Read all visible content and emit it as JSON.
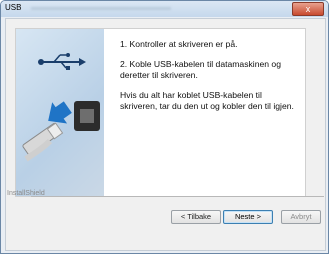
{
  "window": {
    "title": "USB",
    "close_label": "x"
  },
  "content": {
    "step1": "1. Kontroller at skriveren er på.",
    "step2": "2. Koble USB-kabelen til datamaskinen og deretter til skriveren.",
    "note": "Hvis du alt har koblet USB-kabelen til skriveren, tar du den ut og kobler den til igjen."
  },
  "footer": {
    "brand": "InstallShield"
  },
  "buttons": {
    "back": "< Tilbake",
    "next": "Neste >",
    "cancel": "Avbryt"
  },
  "icons": {
    "usb": "usb-icon",
    "arrow": "arrow-right-icon",
    "plug": "usb-plug-icon"
  },
  "colors": {
    "accent": "#1f74c6",
    "title_bar": "#c5d8ec",
    "close": "#c84a2f"
  }
}
